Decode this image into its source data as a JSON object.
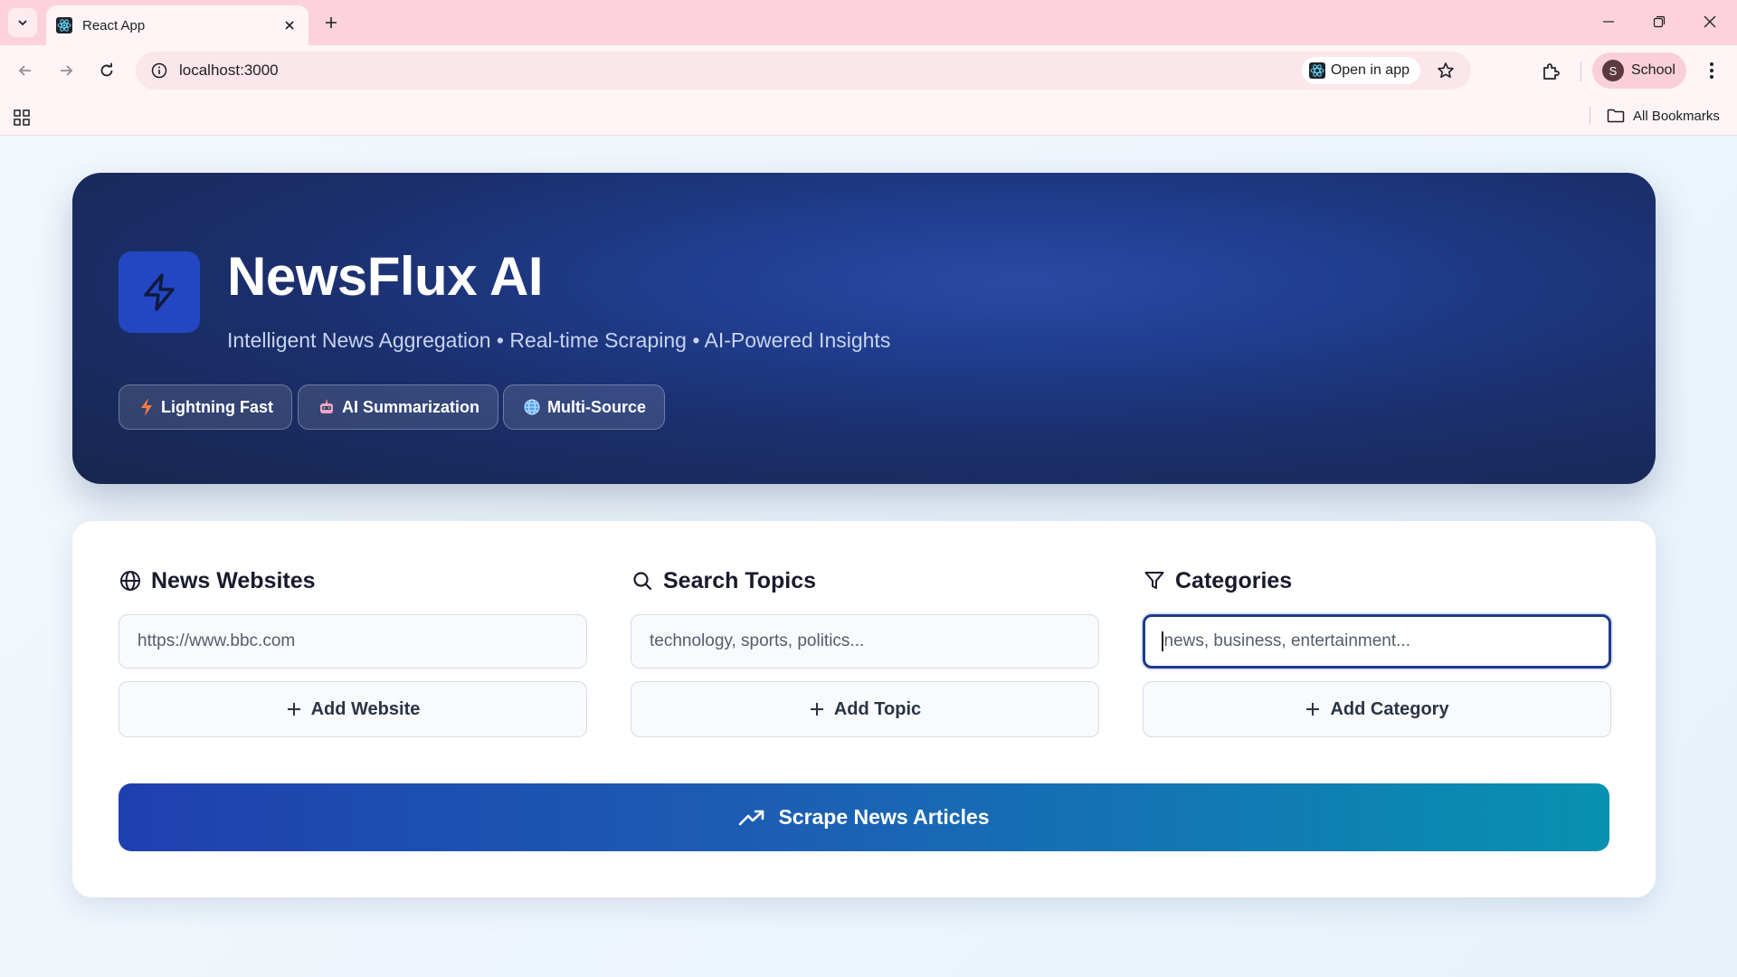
{
  "browser": {
    "tab_title": "React App",
    "url": "localhost:3000",
    "open_in_app_label": "Open in app",
    "profile_initial": "S",
    "profile_name": "School",
    "all_bookmarks_label": "All Bookmarks"
  },
  "hero": {
    "title": "NewsFlux AI",
    "subtitle": "Intelligent News Aggregation • Real-time Scraping • AI-Powered Insights",
    "badges": [
      {
        "icon": "lightning-icon",
        "label": "Lightning Fast"
      },
      {
        "icon": "robot-icon",
        "label": "AI Summarization"
      },
      {
        "icon": "globe-icon",
        "label": "Multi-Source"
      }
    ]
  },
  "panel": {
    "websites": {
      "title": "News Websites",
      "icon": "globe-icon",
      "placeholder": "https://www.bbc.com",
      "button": "Add Website"
    },
    "topics": {
      "title": "Search Topics",
      "icon": "search-icon",
      "placeholder": "technology, sports, politics...",
      "button": "Add Topic"
    },
    "categories": {
      "title": "Categories",
      "icon": "filter-icon",
      "placeholder": "news, business, entertainment...",
      "button": "Add Category"
    },
    "scrape_button": "Scrape News Articles"
  },
  "colors": {
    "hero_bg": "#1b2f6c",
    "logo_bg": "#2347c2",
    "focus_border": "#1e3a8a",
    "button_gradient_start": "#1e40af",
    "button_gradient_end": "#0891b2"
  }
}
